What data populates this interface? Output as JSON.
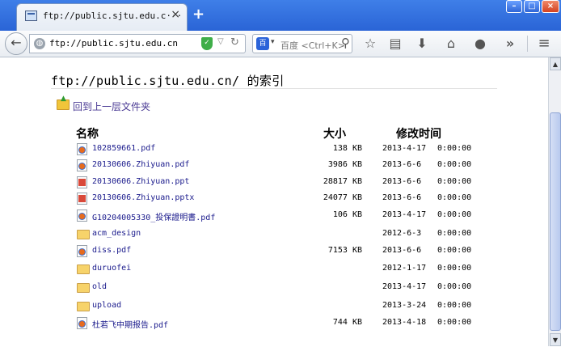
{
  "tab": {
    "title": "ftp://public.sjtu.edu.c···",
    "close": "×",
    "new_tab": "+"
  },
  "window_controls": {
    "minimize": "–",
    "maximize": "□",
    "close": "×"
  },
  "navbar": {
    "back": "←",
    "url": "ftp://public.sjtu.edu.cn",
    "search_placeholder": "百度 <Ctrl+K>",
    "search_engine": "百",
    "more": "»",
    "menu": "≡"
  },
  "page": {
    "title": "ftp://public.sjtu.edu.cn/ 的索引",
    "up_link": "回到上一层文件夹",
    "headers": {
      "name": "名称",
      "size": "大小",
      "modified": "修改时间"
    }
  },
  "files": [
    {
      "type": "pdf",
      "name": "102859661.pdf",
      "size": "138 KB",
      "date": "2013-4-17",
      "time": "0:00:00"
    },
    {
      "type": "pdf",
      "name": "20130606.Zhiyuan.pdf",
      "size": "3986 KB",
      "date": "2013-6-6",
      "time": "0:00:00"
    },
    {
      "type": "ppt",
      "name": "20130606.Zhiyuan.ppt",
      "size": "28817 KB",
      "date": "2013-6-6",
      "time": "0:00:00"
    },
    {
      "type": "ppt",
      "name": "20130606.Zhiyuan.pptx",
      "size": "24077 KB",
      "date": "2013-6-6",
      "time": "0:00:00"
    },
    {
      "type": "pdf",
      "name": "G10204005330_投保證明書.pdf",
      "size": "106 KB",
      "date": "2013-4-17",
      "time": "0:00:00"
    },
    {
      "type": "folder",
      "name": "acm_design",
      "size": "",
      "date": "2012-6-3",
      "time": "0:00:00"
    },
    {
      "type": "pdf",
      "name": "diss.pdf",
      "size": "7153 KB",
      "date": "2013-6-6",
      "time": "0:00:00"
    },
    {
      "type": "folder",
      "name": "duruofei",
      "size": "",
      "date": "2012-1-17",
      "time": "0:00:00"
    },
    {
      "type": "folder",
      "name": "old",
      "size": "",
      "date": "2013-4-17",
      "time": "0:00:00"
    },
    {
      "type": "folder",
      "name": "upload",
      "size": "",
      "date": "2013-3-24",
      "time": "0:00:00"
    },
    {
      "type": "pdf",
      "name": "杜若飞中期报告.pdf",
      "size": "744 KB",
      "date": "2013-4-18",
      "time": "0:00:00"
    }
  ]
}
